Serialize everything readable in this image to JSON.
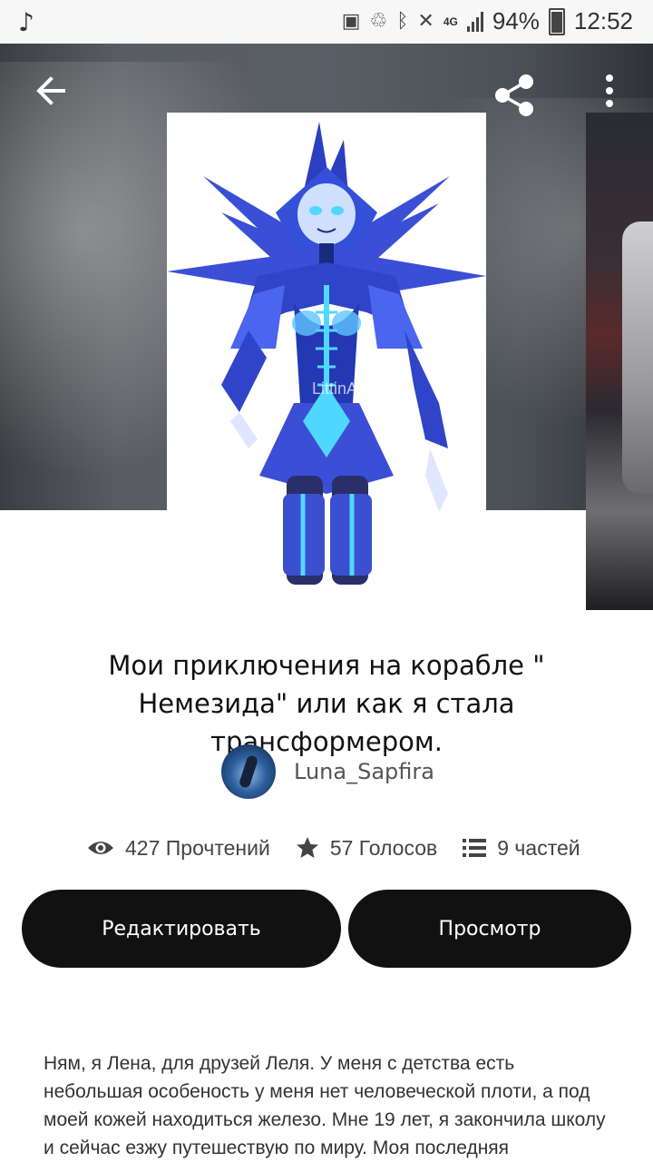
{
  "status_bar": {
    "battery": "94%",
    "time": "12:52",
    "network": "4G"
  },
  "toolbar": {
    "back_icon": "arrow-left-icon",
    "share_icon": "share-icon",
    "more_icon": "more-vert-icon"
  },
  "cover": {
    "watermark": "LittinApoc"
  },
  "story": {
    "title": "Мои приключения на корабле \" Немезида\" или как я стала трансформером.",
    "author": "Luna_Sapfira",
    "stats": {
      "reads": "427 Прочтений",
      "votes": "57 Голосов",
      "parts": "9 частей"
    }
  },
  "buttons": {
    "edit": "Редактировать",
    "view": "Просмотр"
  },
  "description": "Ням, я Лена, для друзей Леля. У меня с детства есть небольшая особеность у меня нет человеческой плоти, а под моей кожей находиться железо. Мне 19 лет, я закончила школу и сейчас езжу путешествую по миру. Моя последняя",
  "colors": {
    "button_bg": "#111111",
    "accent_blue": "#3a4fd6",
    "neon_blue": "#4fd8ff"
  }
}
